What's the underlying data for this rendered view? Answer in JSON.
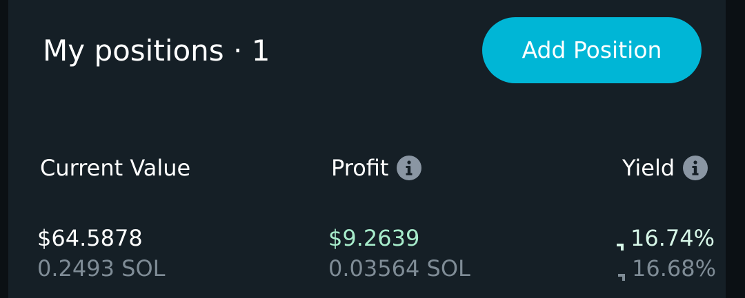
{
  "header": {
    "title": "My positions · 1",
    "add_button_label": "Add Position"
  },
  "columns": {
    "current_value": {
      "label": "Current Value",
      "usd": "$64.5878",
      "sol": "0.2493 SOL"
    },
    "profit": {
      "label": "Profit",
      "usd": "$9.2639",
      "sol": "0.03564 SOL"
    },
    "yield": {
      "label": "Yield",
      "primary": "16.74%",
      "secondary": "16.68%"
    }
  },
  "icons": {
    "info": "info-icon",
    "trend": "arrow-up-right-icon"
  },
  "colors": {
    "accent": "#00b6d6",
    "profit_green": "#a7eccb",
    "muted": "#7f8c96",
    "card_bg": "#151f26"
  }
}
